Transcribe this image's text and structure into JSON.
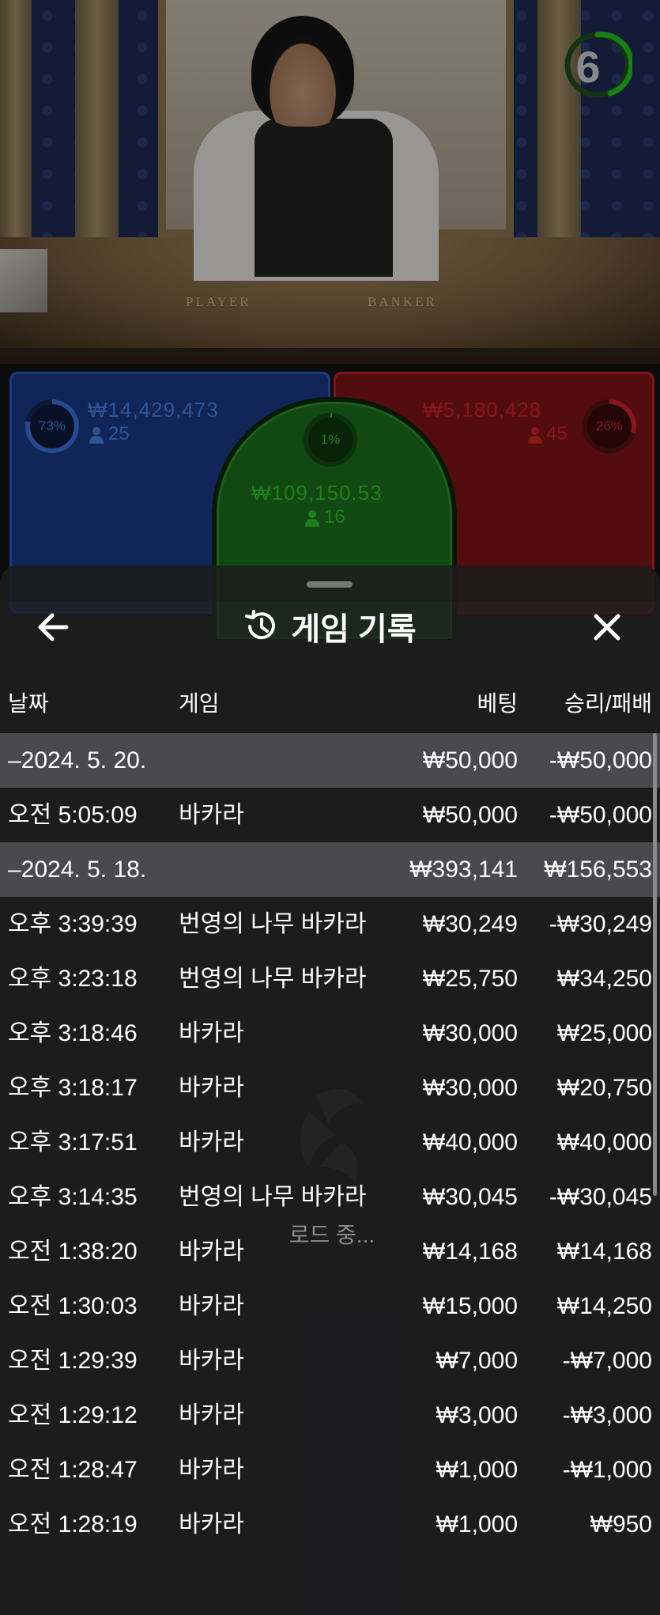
{
  "video": {
    "countdown": "6",
    "table_labels": {
      "player": "PLAYER",
      "banker": "BANKER"
    }
  },
  "board": {
    "player": {
      "percent": "73%",
      "amount": "₩14,429,473",
      "players": "25"
    },
    "tie": {
      "percent": "1%",
      "amount": "₩109,150.53",
      "players": "16"
    },
    "banker": {
      "amount": "₩5,180,428",
      "players": "45",
      "percent": "26%"
    }
  },
  "sheet": {
    "title": "게임 기록",
    "columns": {
      "date": "날짜",
      "game": "게임",
      "bet": "베팅",
      "win": "승리/패배"
    },
    "rows": [
      {
        "type": "group",
        "date": "–2024. 5. 20.",
        "game": "",
        "bet": "₩50,000",
        "win": "-₩50,000"
      },
      {
        "type": "item",
        "date": "오전 5:05:09",
        "game": "바카라",
        "bet": "₩50,000",
        "win": "-₩50,000"
      },
      {
        "type": "group",
        "date": "–2024. 5. 18.",
        "game": "",
        "bet": "₩393,141",
        "win": "₩156,553"
      },
      {
        "type": "item",
        "date": "오후 3:39:39",
        "game": "번영의 나무 바카라",
        "bet": "₩30,249",
        "win": "-₩30,249"
      },
      {
        "type": "item",
        "date": "오후 3:23:18",
        "game": "번영의 나무 바카라",
        "bet": "₩25,750",
        "win": "₩34,250"
      },
      {
        "type": "item",
        "date": "오후 3:18:46",
        "game": "바카라",
        "bet": "₩30,000",
        "win": "₩25,000"
      },
      {
        "type": "item",
        "date": "오후 3:18:17",
        "game": "바카라",
        "bet": "₩30,000",
        "win": "₩20,750"
      },
      {
        "type": "item",
        "date": "오후 3:17:51",
        "game": "바카라",
        "bet": "₩40,000",
        "win": "₩40,000"
      },
      {
        "type": "item",
        "date": "오후 3:14:35",
        "game": "번영의 나무 바카라",
        "bet": "₩30,045",
        "win": "-₩30,045"
      },
      {
        "type": "item",
        "date": "오전 1:38:20",
        "game": "바카라",
        "bet": "₩14,168",
        "win": "₩14,168"
      },
      {
        "type": "item",
        "date": "오전 1:30:03",
        "game": "바카라",
        "bet": "₩15,000",
        "win": "₩14,250"
      },
      {
        "type": "item",
        "date": "오전 1:29:39",
        "game": "바카라",
        "bet": "₩7,000",
        "win": "-₩7,000"
      },
      {
        "type": "item",
        "date": "오전 1:29:12",
        "game": "바카라",
        "bet": "₩3,000",
        "win": "-₩3,000"
      },
      {
        "type": "item",
        "date": "오전 1:28:47",
        "game": "바카라",
        "bet": "₩1,000",
        "win": "-₩1,000"
      },
      {
        "type": "item",
        "date": "오전 1:28:19",
        "game": "바카라",
        "bet": "₩1,000",
        "win": "₩950"
      }
    ],
    "loading_text": "로드 중..."
  }
}
